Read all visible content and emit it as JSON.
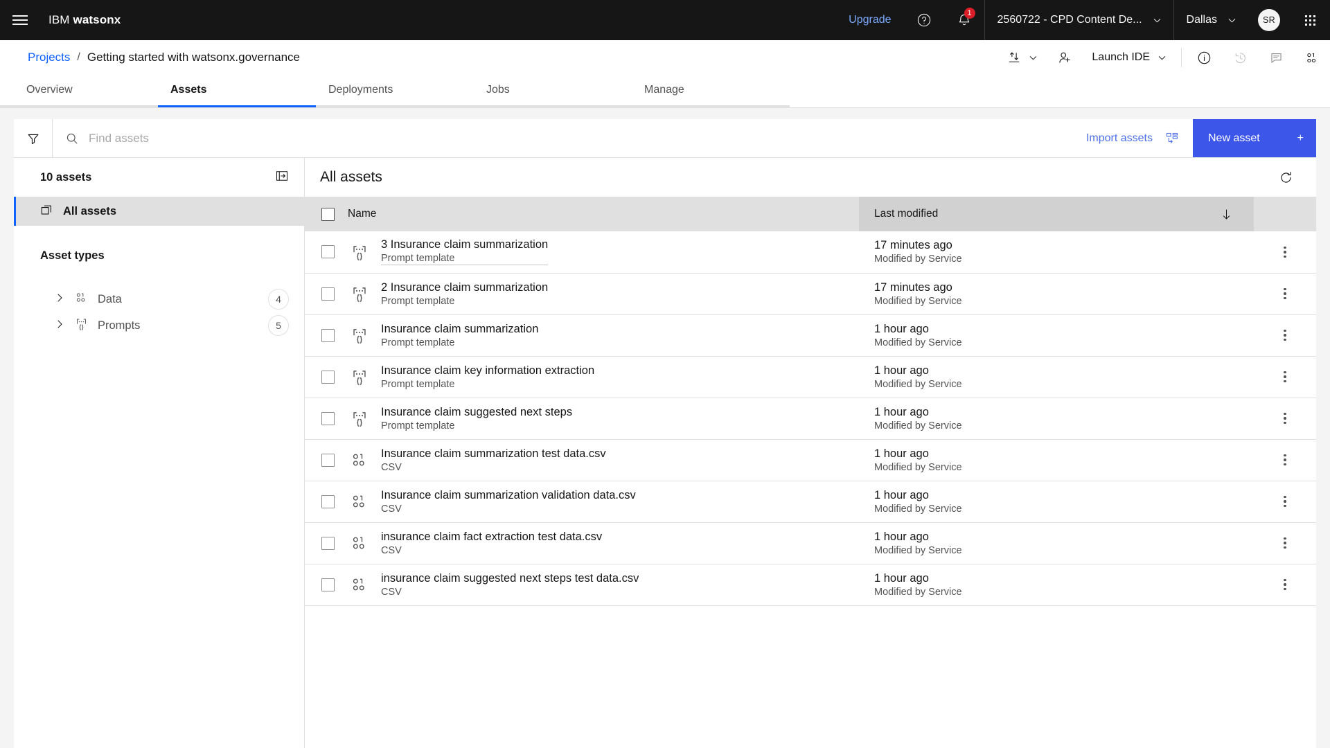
{
  "header": {
    "menu_icon": "hamburger-menu-icon",
    "brand_ibm": "IBM",
    "brand_product": "watsonx",
    "upgrade_label": "Upgrade",
    "help_icon": "help-circle-icon",
    "notifications_icon": "bell-icon",
    "notification_count": "1",
    "account_label": "2560722 - CPD Content De...",
    "region_label": "Dallas",
    "avatar_initials": "SR",
    "app_switcher_icon": "app-grid-icon"
  },
  "breadcrumb": {
    "parent": "Projects",
    "separator": "/",
    "current": "Getting started with watsonx.governance",
    "actions": {
      "import_export_icon": "upload-download-icon",
      "caret_icon": "chevron-down-icon",
      "add_collaborator_icon": "add-user-icon",
      "launch_ide_label": "Launch IDE",
      "launch_ide_caret": "chevron-down-icon",
      "info_icon": "information-icon",
      "history_icon": "recent-history-icon",
      "comments_icon": "comment-icon",
      "data_icon": "data-binary-icon"
    }
  },
  "tabs": [
    {
      "label": "Overview",
      "active": false
    },
    {
      "label": "Assets",
      "active": true
    },
    {
      "label": "Deployments",
      "active": false
    },
    {
      "label": "Jobs",
      "active": false
    },
    {
      "label": "Manage",
      "active": false
    }
  ],
  "toolbar": {
    "filter_icon": "filter-icon",
    "search_icon": "search-icon",
    "search_value": "",
    "search_placeholder": "Find assets",
    "import_label": "Import assets",
    "import_icon": "import-assets-icon",
    "new_asset_label": "New asset",
    "new_asset_plus": "+",
    "accent_color": "#3b56e8"
  },
  "sidebar": {
    "count_label": "10 assets",
    "collapse_icon": "panel-collapse-icon",
    "all_assets": {
      "label": "All assets",
      "icon": "copy-stack-icon",
      "selected": true
    },
    "section_title": "Asset types",
    "types": [
      {
        "label": "Data",
        "count": "4",
        "icon": "data-binary-icon",
        "chevron": "chevron-right-icon"
      },
      {
        "label": "Prompts",
        "count": "5",
        "icon": "prompt-template-icon",
        "chevron": "chevron-right-icon"
      }
    ]
  },
  "content": {
    "title": "All assets",
    "refresh_icon": "refresh-icon",
    "columns": {
      "select_all": "select-all-checkbox",
      "name": "Name",
      "last_modified": "Last modified",
      "sort_icon": "arrow-down-icon"
    },
    "rows": [
      {
        "name": "3 Insurance claim summarization",
        "type": "Prompt template",
        "icon": "prompt-template-icon",
        "modified": "17 minutes ago",
        "modified_by": "Modified by Service",
        "hovered": true
      },
      {
        "name": "2 Insurance claim summarization",
        "type": "Prompt template",
        "icon": "prompt-template-icon",
        "modified": "17 minutes ago",
        "modified_by": "Modified by Service",
        "hovered": false
      },
      {
        "name": "Insurance claim summarization",
        "type": "Prompt template",
        "icon": "prompt-template-icon",
        "modified": "1 hour ago",
        "modified_by": "Modified by Service",
        "hovered": false
      },
      {
        "name": "Insurance claim key information extraction",
        "type": "Prompt template",
        "icon": "prompt-template-icon",
        "modified": "1 hour ago",
        "modified_by": "Modified by Service",
        "hovered": false
      },
      {
        "name": "Insurance claim suggested next steps",
        "type": "Prompt template",
        "icon": "prompt-template-icon",
        "modified": "1 hour ago",
        "modified_by": "Modified by Service",
        "hovered": false
      },
      {
        "name": "Insurance claim summarization test data.csv",
        "type": "CSV",
        "icon": "data-binary-icon",
        "modified": "1 hour ago",
        "modified_by": "Modified by Service",
        "hovered": false
      },
      {
        "name": "Insurance claim summarization validation data.csv",
        "type": "CSV",
        "icon": "data-binary-icon",
        "modified": "1 hour ago",
        "modified_by": "Modified by Service",
        "hovered": false
      },
      {
        "name": "insurance claim fact extraction test data.csv",
        "type": "CSV",
        "icon": "data-binary-icon",
        "modified": "1 hour ago",
        "modified_by": "Modified by Service",
        "hovered": false
      },
      {
        "name": "insurance claim suggested next steps test data.csv",
        "type": "CSV",
        "icon": "data-binary-icon",
        "modified": "1 hour ago",
        "modified_by": "Modified by Service",
        "hovered": false
      }
    ],
    "row_menu_icon": "overflow-menu-icon"
  }
}
